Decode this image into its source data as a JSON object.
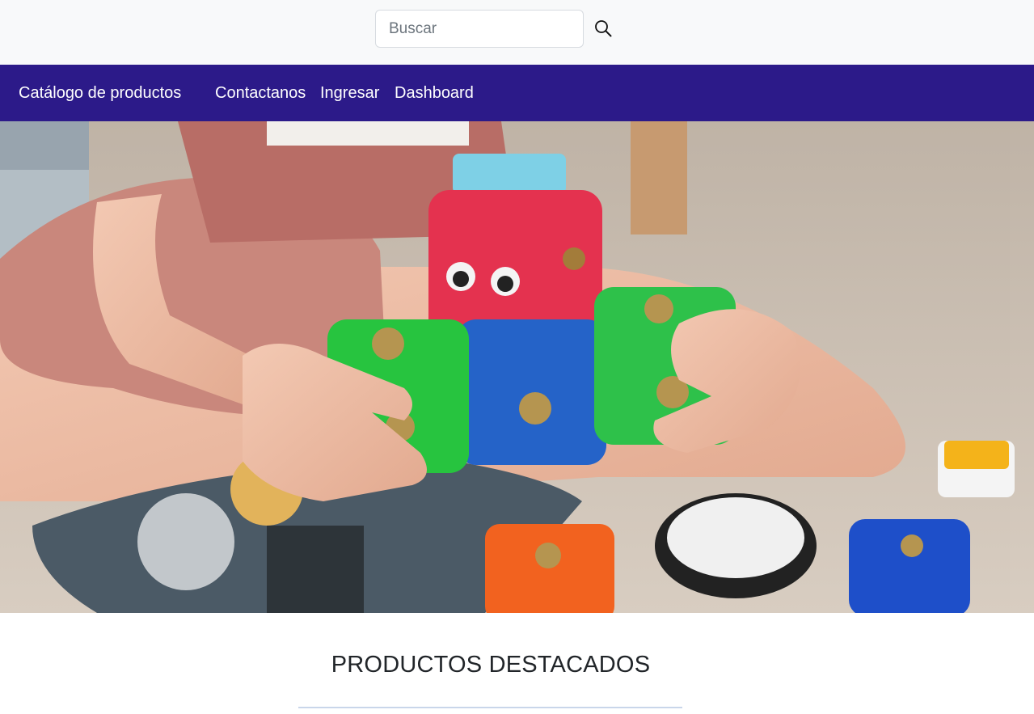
{
  "search": {
    "placeholder": "Buscar",
    "value": "",
    "icon": "search-icon"
  },
  "navbar": {
    "background": "#2c1a89",
    "brand": "Catálogo de productos",
    "links": [
      {
        "label": "Contactanos"
      },
      {
        "label": "Ingresar"
      },
      {
        "label": "Dashboard"
      }
    ]
  },
  "hero": {
    "image": "child-holding-robot-toy-cubes"
  },
  "featured": {
    "title": "PRODUCTOS DESTACADOS"
  }
}
